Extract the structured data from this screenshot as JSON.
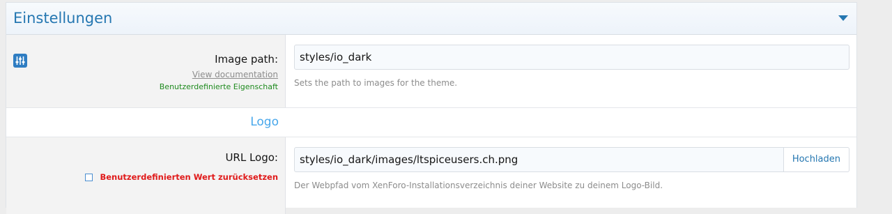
{
  "header": {
    "title": "Einstellungen",
    "toggle_icon": "chevron-down-icon"
  },
  "image_path": {
    "icon": "sliders-icon",
    "label": "Image path:",
    "doc_link": "View documentation",
    "custom_property": "Benutzerdefinierte Eigenschaft",
    "value": "styles/io_dark",
    "hint": "Sets the path to images for the theme."
  },
  "logo_section": {
    "label": "Logo"
  },
  "url_logo": {
    "label": "URL Logo:",
    "reset_label": "Benutzerdefinierten Wert zurücksetzen",
    "value": "styles/io_dark/images/ltspiceusers.ch.png",
    "upload_label": "Hochladen",
    "hint": "Der Webpfad vom XenForo-Installationsverzeichnis deiner Website zu deinem Logo-Bild."
  },
  "colors": {
    "accent": "#2577b1",
    "section_label": "#47a7eb",
    "custom_green": "#1e8a1e",
    "reset_red": "#e01a1a"
  }
}
